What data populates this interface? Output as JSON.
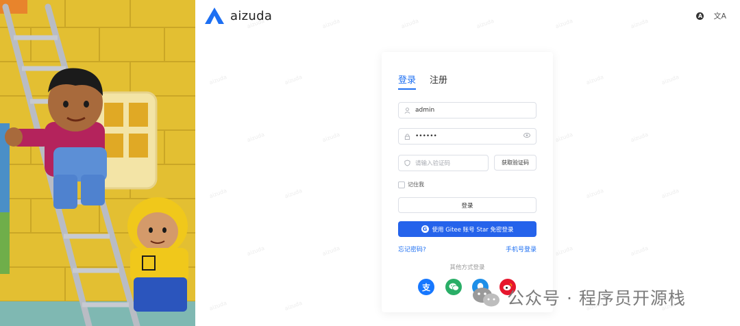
{
  "brand": {
    "name": "aizuda",
    "color": "#1d6ff2"
  },
  "top_actions": {
    "theme_icon": "A",
    "lang_icon": "文A"
  },
  "login": {
    "tabs": [
      "登录",
      "注册"
    ],
    "username": {
      "value": "admin"
    },
    "password": {
      "value": "••••••"
    },
    "code": {
      "placeholder": "请输入验证码",
      "button": "获取验证码"
    },
    "remember": "记住我",
    "submit": "登录",
    "gitee": "使用 Gitee 账号 Star 免密登录",
    "forgot": "忘记密码?",
    "phone_login": "手机号登录",
    "other_label": "其他方式登录",
    "socials": [
      {
        "name": "alipay",
        "glyph": "支"
      },
      {
        "name": "wechat",
        "glyph": "✉"
      },
      {
        "name": "qq",
        "glyph": "Q"
      },
      {
        "name": "weibo",
        "glyph": "微"
      }
    ]
  },
  "watermark_label": "公众号 · 程序员开源栈",
  "watermark_tile": "aizuda"
}
